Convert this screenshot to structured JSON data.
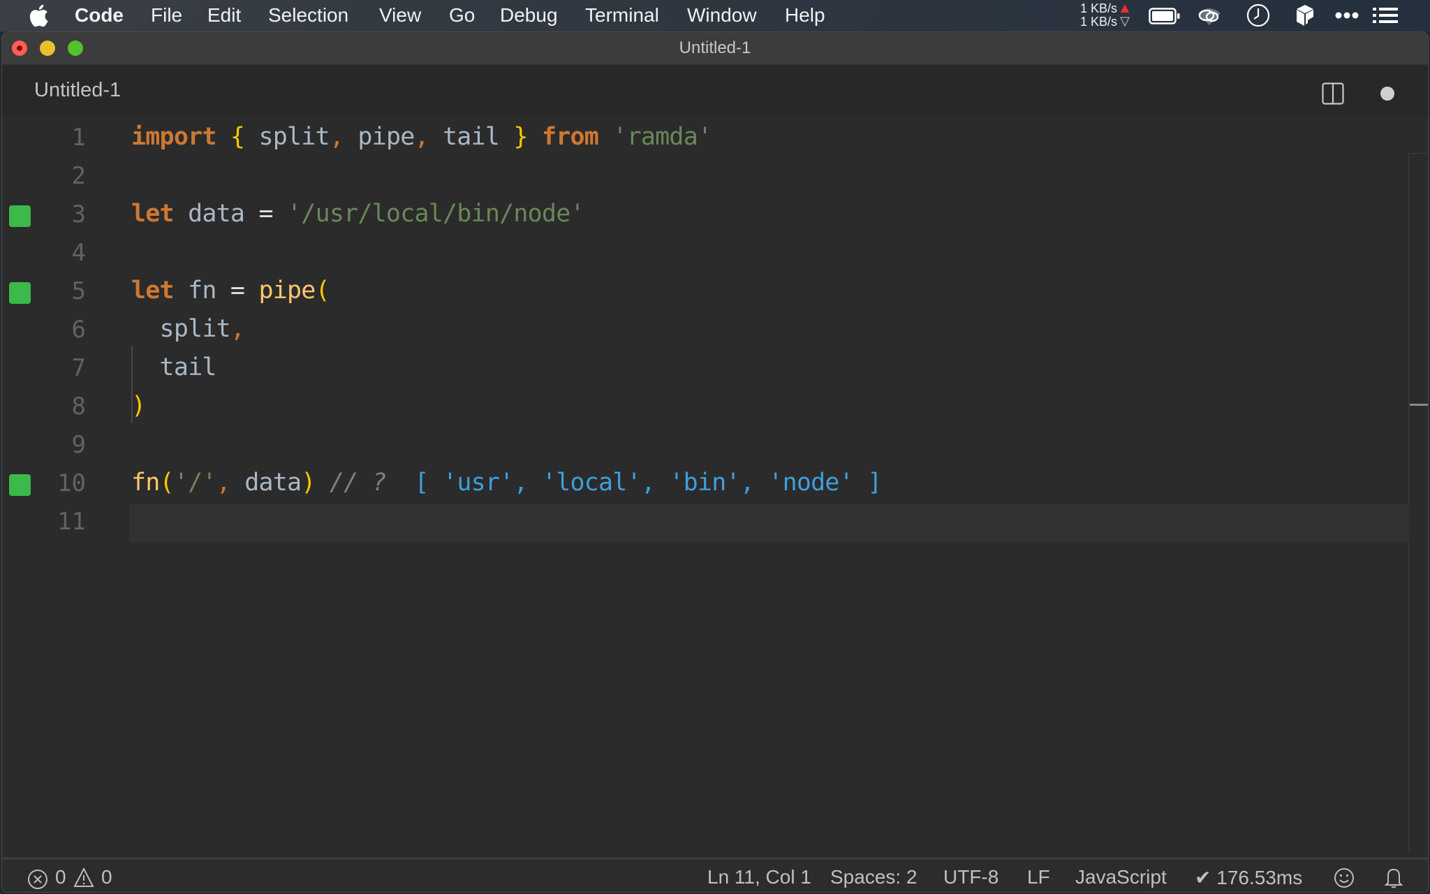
{
  "menubar": {
    "app_name": "Code",
    "items": [
      "File",
      "Edit",
      "Selection",
      "View",
      "Go",
      "Debug",
      "Terminal",
      "Window",
      "Help"
    ],
    "network": {
      "upload": "1 KB/s",
      "download": "1 KB/s"
    },
    "tray_icons": [
      "battery-icon",
      "creative-cloud-icon",
      "clock-icon",
      "box-icon",
      "more-icon",
      "list-icon"
    ]
  },
  "window": {
    "title": "Untitled-1",
    "tab": {
      "label": "Untitled-1",
      "dirty": true
    }
  },
  "editor": {
    "language": "JavaScript",
    "lines": [
      {
        "n": "1",
        "marker": false,
        "tokens": [
          [
            "kw",
            "import"
          ],
          [
            "id",
            " "
          ],
          [
            "br",
            "{"
          ],
          [
            "id",
            " split"
          ],
          [
            "cm",
            ","
          ],
          [
            "id",
            " pipe"
          ],
          [
            "cm",
            ","
          ],
          [
            "id",
            " tail "
          ],
          [
            "br",
            "}"
          ],
          [
            "id",
            " "
          ],
          [
            "kw",
            "from"
          ],
          [
            "id",
            " "
          ],
          [
            "str",
            "'ramda'"
          ]
        ]
      },
      {
        "n": "2",
        "marker": false,
        "tokens": []
      },
      {
        "n": "3",
        "marker": true,
        "tokens": [
          [
            "kw",
            "let"
          ],
          [
            "id",
            " data "
          ],
          [
            "op",
            "="
          ],
          [
            "id",
            " "
          ],
          [
            "str",
            "'/usr/local/bin/node'"
          ]
        ]
      },
      {
        "n": "4",
        "marker": false,
        "tokens": []
      },
      {
        "n": "5",
        "marker": true,
        "tokens": [
          [
            "kw",
            "let"
          ],
          [
            "id",
            " fn "
          ],
          [
            "op",
            "="
          ],
          [
            "id",
            " "
          ],
          [
            "fn",
            "pipe"
          ],
          [
            "br",
            "("
          ]
        ]
      },
      {
        "n": "6",
        "marker": false,
        "tokens": [
          [
            "id",
            "  split"
          ],
          [
            "cm",
            ","
          ]
        ]
      },
      {
        "n": "7",
        "marker": false,
        "tokens": [
          [
            "id",
            "  tail"
          ]
        ]
      },
      {
        "n": "8",
        "marker": false,
        "tokens": [
          [
            "br",
            ")"
          ]
        ]
      },
      {
        "n": "9",
        "marker": false,
        "tokens": []
      },
      {
        "n": "10",
        "marker": true,
        "tokens": [
          [
            "fn",
            "fn"
          ],
          [
            "br",
            "("
          ],
          [
            "str",
            "'/'"
          ],
          [
            "cm",
            ","
          ],
          [
            "id",
            " data"
          ],
          [
            "br",
            ")"
          ],
          [
            "id",
            " "
          ],
          [
            "comment",
            "// ?"
          ],
          [
            "id",
            "  "
          ],
          [
            "result",
            "[ 'usr', 'local', 'bin', 'node' ]"
          ]
        ]
      },
      {
        "n": "11",
        "marker": false,
        "tokens": [],
        "current": true
      }
    ]
  },
  "statusbar": {
    "errors": "0",
    "warnings": "0",
    "position": "Ln 11, Col 1",
    "indent": "Spaces: 2",
    "encoding": "UTF-8",
    "eol": "LF",
    "language": "JavaScript",
    "timing": "✔ 176.53ms"
  },
  "colors": {
    "keyword": "#cc7832",
    "bracket": "#ffc700",
    "identifier": "#a9b7c6",
    "string": "#6a8759",
    "function": "#ffc66d",
    "comment": "#808080",
    "inline_result": "#3d9fdc",
    "gutter_marker": "#3bb94a"
  }
}
